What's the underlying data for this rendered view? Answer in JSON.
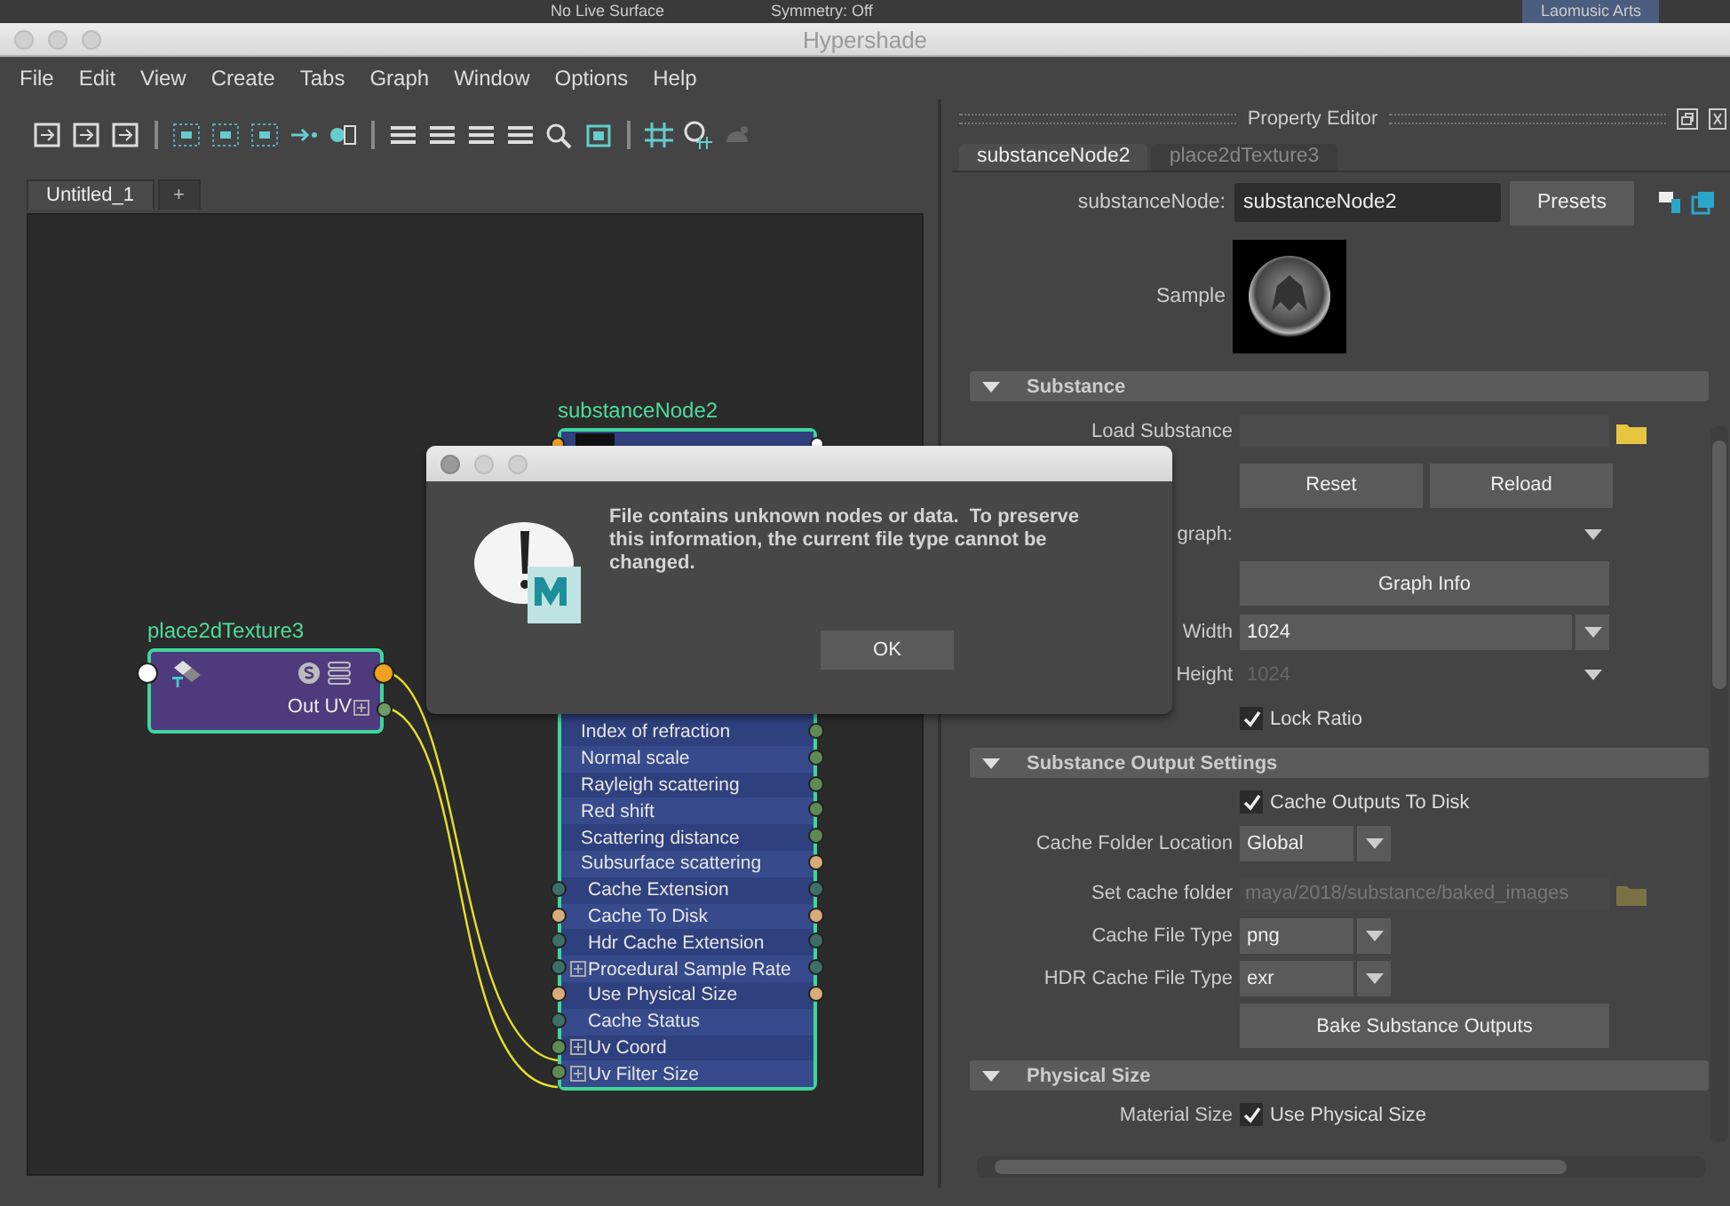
{
  "top_bar": {
    "items": [
      "No Live Surface",
      "Symmetry: Off"
    ],
    "user": "Laomusic Arts"
  },
  "window": {
    "title": "Hypershade"
  },
  "menu": [
    "File",
    "Edit",
    "View",
    "Create",
    "Tabs",
    "Graph",
    "Window",
    "Options",
    "Help"
  ],
  "graph_tabs": [
    {
      "label": "Untitled_1",
      "selected": true
    }
  ],
  "add_tab": "+",
  "nodes": [
    {
      "kind": "texture",
      "title": "place2dTexture3",
      "output": "Out UV"
    },
    {
      "kind": "substance",
      "title": "substanceNode2",
      "rows": [
        {
          "label": "Index of refraction",
          "kind": "output",
          "right_port": {
            "color": "#5f8a55"
          }
        },
        {
          "label": "Normal scale",
          "kind": "output",
          "right_port": {
            "color": "#5f8a55"
          }
        },
        {
          "label": "Rayleigh scattering",
          "kind": "output",
          "right_port": {
            "color": "#5f8a55"
          }
        },
        {
          "label": "Red shift",
          "kind": "output",
          "right_port": {
            "color": "#5f8a55"
          }
        },
        {
          "label": "Scattering distance",
          "kind": "output",
          "right_port": {
            "color": "#5f8a55"
          }
        },
        {
          "label": "Subsurface scattering",
          "kind": "output",
          "right_port": {
            "color": "#d9aa7a"
          }
        },
        {
          "label": "Cache Extension",
          "kind": "attribute",
          "left_port": {
            "color": "#3f6e66"
          },
          "right_port": {
            "color": "#3f6e66"
          },
          "expandable": false
        },
        {
          "label": "Cache To Disk",
          "kind": "attribute",
          "left_port": {
            "color": "#d9aa7a"
          },
          "right_port": {
            "color": "#d9aa7a"
          },
          "expandable": false
        },
        {
          "label": "Hdr Cache Extension",
          "kind": "attribute",
          "left_port": {
            "color": "#3f6e66"
          },
          "right_port": {
            "color": "#3f6e66"
          },
          "expandable": false
        },
        {
          "label": "Procedural Sample Rate",
          "kind": "attribute",
          "left_port": {
            "color": "#3f6e66"
          },
          "right_port": {
            "color": "#3f6e66"
          },
          "expandable": true
        },
        {
          "label": "Use Physical Size",
          "kind": "attribute",
          "left_port": {
            "color": "#d9aa7a"
          },
          "right_port": {
            "color": "#d9aa7a"
          },
          "expandable": false
        },
        {
          "label": "Cache Status",
          "kind": "attribute",
          "left_port": {
            "color": "#3f6e66"
          },
          "expandable": false
        },
        {
          "label": "Uv Coord",
          "kind": "attribute",
          "left_port": {
            "color": "#5f8a55"
          },
          "expandable": true
        },
        {
          "label": "Uv Filter Size",
          "kind": "attribute",
          "left_port": {
            "color": "#5f8a55"
          },
          "expandable": true
        }
      ]
    }
  ],
  "dialog": {
    "message": "File contains unknown nodes or data.  To preserve this information, the current file type cannot be changed.",
    "button": "OK"
  },
  "property_editor": {
    "title": "Property Editor",
    "tabs": [
      {
        "label": "substanceNode2",
        "selected": true
      },
      {
        "label": "place2dTexture3",
        "selected": false
      }
    ],
    "node_label": "substanceNode:",
    "node_name": "substanceNode2",
    "presets_button": "Presets",
    "sample_label": "Sample",
    "sections": [
      {
        "title": "Substance",
        "expanded": true,
        "rows": [
          {
            "kind": "file",
            "label": "Load Substance",
            "disabled": false
          },
          {
            "kind": "buttons",
            "buttons": [
              "Reset",
              "Reload"
            ]
          },
          {
            "kind": "dropdown",
            "label": "graph:",
            "disabled": true
          },
          {
            "kind": "button",
            "label": "Graph Info"
          },
          {
            "kind": "dropdown",
            "label": "Width",
            "value": "1024",
            "disabled": false
          },
          {
            "kind": "dropdown",
            "label": "Height",
            "value": "1024",
            "disabled": true
          },
          {
            "kind": "checkbox",
            "text": "Lock Ratio",
            "checked": true
          }
        ]
      },
      {
        "title": "Substance Output Settings",
        "expanded": true,
        "rows": [
          {
            "kind": "checkbox",
            "text": "Cache Outputs To Disk",
            "checked": true
          },
          {
            "kind": "combo",
            "label": "Cache Folder Location",
            "value": "Global"
          },
          {
            "kind": "file",
            "label": "Set cache folder",
            "value": "maya/2018/substance/baked_images",
            "disabled": true
          },
          {
            "kind": "combo",
            "label": "Cache File Type",
            "value": "png"
          },
          {
            "kind": "combo",
            "label": "HDR Cache File Type",
            "value": "exr"
          },
          {
            "kind": "button",
            "label": "Bake Substance Outputs"
          }
        ]
      },
      {
        "title": "Physical Size",
        "expanded": true,
        "rows": [
          {
            "kind": "checkbox",
            "label": "Material Size",
            "text": "Use Physical Size",
            "checked": true
          }
        ]
      }
    ]
  }
}
